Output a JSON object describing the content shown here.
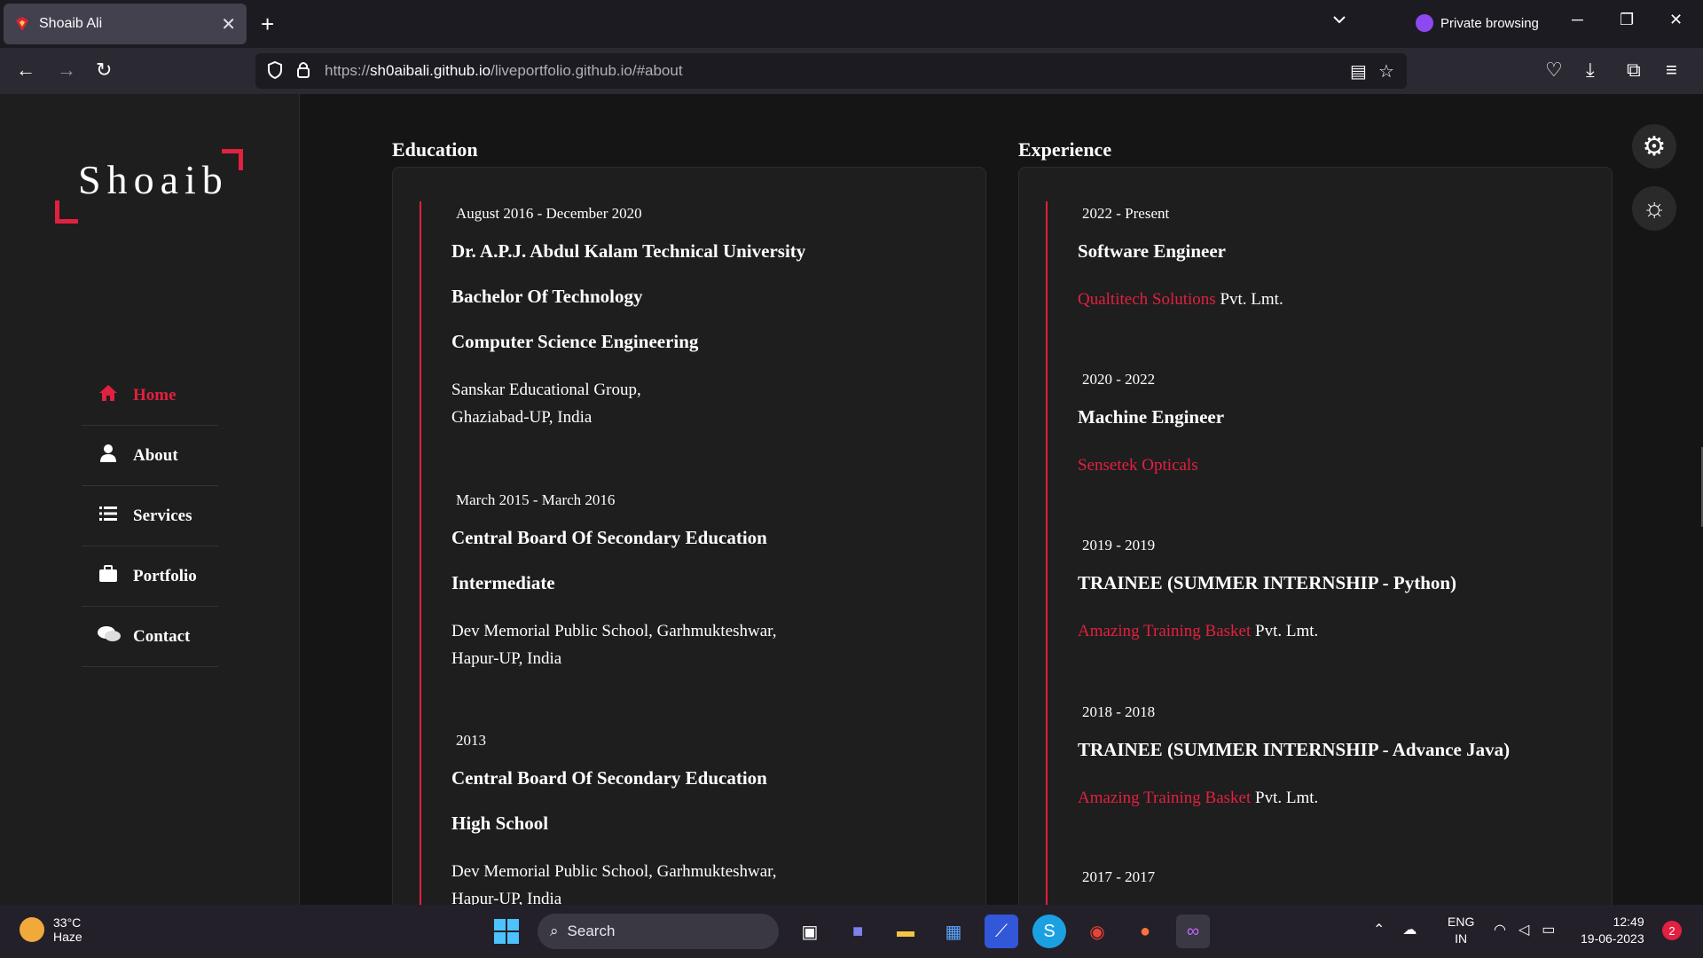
{
  "browser": {
    "tab_title": "Shoaib Ali",
    "private_label": "Private browsing",
    "url_prefix": "https://",
    "url_domain": "sh0aibali.github.io",
    "url_path": "/liveportfolio.github.io/#about"
  },
  "sidebar": {
    "logo_text": "Shoaib",
    "accent_color": "#e2203f",
    "items": [
      {
        "label": "Home",
        "icon": "home-icon",
        "active": true
      },
      {
        "label": "About",
        "icon": "user-icon",
        "active": false
      },
      {
        "label": "Services",
        "icon": "list-icon",
        "active": false
      },
      {
        "label": "Portfolio",
        "icon": "briefcase-icon",
        "active": false
      },
      {
        "label": "Contact",
        "icon": "chat-icon",
        "active": false
      }
    ]
  },
  "education": {
    "title": "Education",
    "entries": [
      {
        "date": "August 2016 - December 2020",
        "institution": "Dr. A.P.J. Abdul Kalam Technical University",
        "degree": "Bachelor Of Technology",
        "field": "Computer Science Engineering",
        "school_line1": "Sanskar Educational Group,",
        "school_line2": "Ghaziabad-UP, India"
      },
      {
        "date": "March 2015 - March 2016",
        "institution": "Central Board Of Secondary Education",
        "degree": "Intermediate",
        "school_line1": "Dev Memorial Public School, Garhmukteshwar,",
        "school_line2": "Hapur-UP, India"
      },
      {
        "date": "2013",
        "institution": "Central Board Of Secondary Education",
        "degree": "High School",
        "school_line1": "Dev Memorial Public School, Garhmukteshwar,",
        "school_line2": "Hapur-UP, India"
      }
    ]
  },
  "experience": {
    "title": "Experience",
    "entries": [
      {
        "date": "2022 - Present",
        "role": "Software Engineer",
        "company": "Qualtitech Solutions",
        "suffix": " Pvt. Lmt."
      },
      {
        "date": "2020 - 2022",
        "role": "Machine Engineer",
        "company": "Sensetek Opticals",
        "suffix": ""
      },
      {
        "date": "2019 - 2019",
        "role": "TRAINEE (SUMMER INTERNSHIP - Python)",
        "company": "Amazing Training Basket",
        "suffix": " Pvt. Lmt."
      },
      {
        "date": "2018 - 2018",
        "role": "TRAINEE (SUMMER INTERNSHIP - Advance Java)",
        "company": "Amazing Training Basket",
        "suffix": " Pvt. Lmt."
      },
      {
        "date": "2017 - 2017"
      }
    ]
  },
  "taskbar": {
    "temperature": "33°C",
    "weather": "Haze",
    "search_label": "Search",
    "lang1": "ENG",
    "lang2": "IN",
    "time": "12:49",
    "date": "19-06-2023",
    "notifications": "2"
  }
}
